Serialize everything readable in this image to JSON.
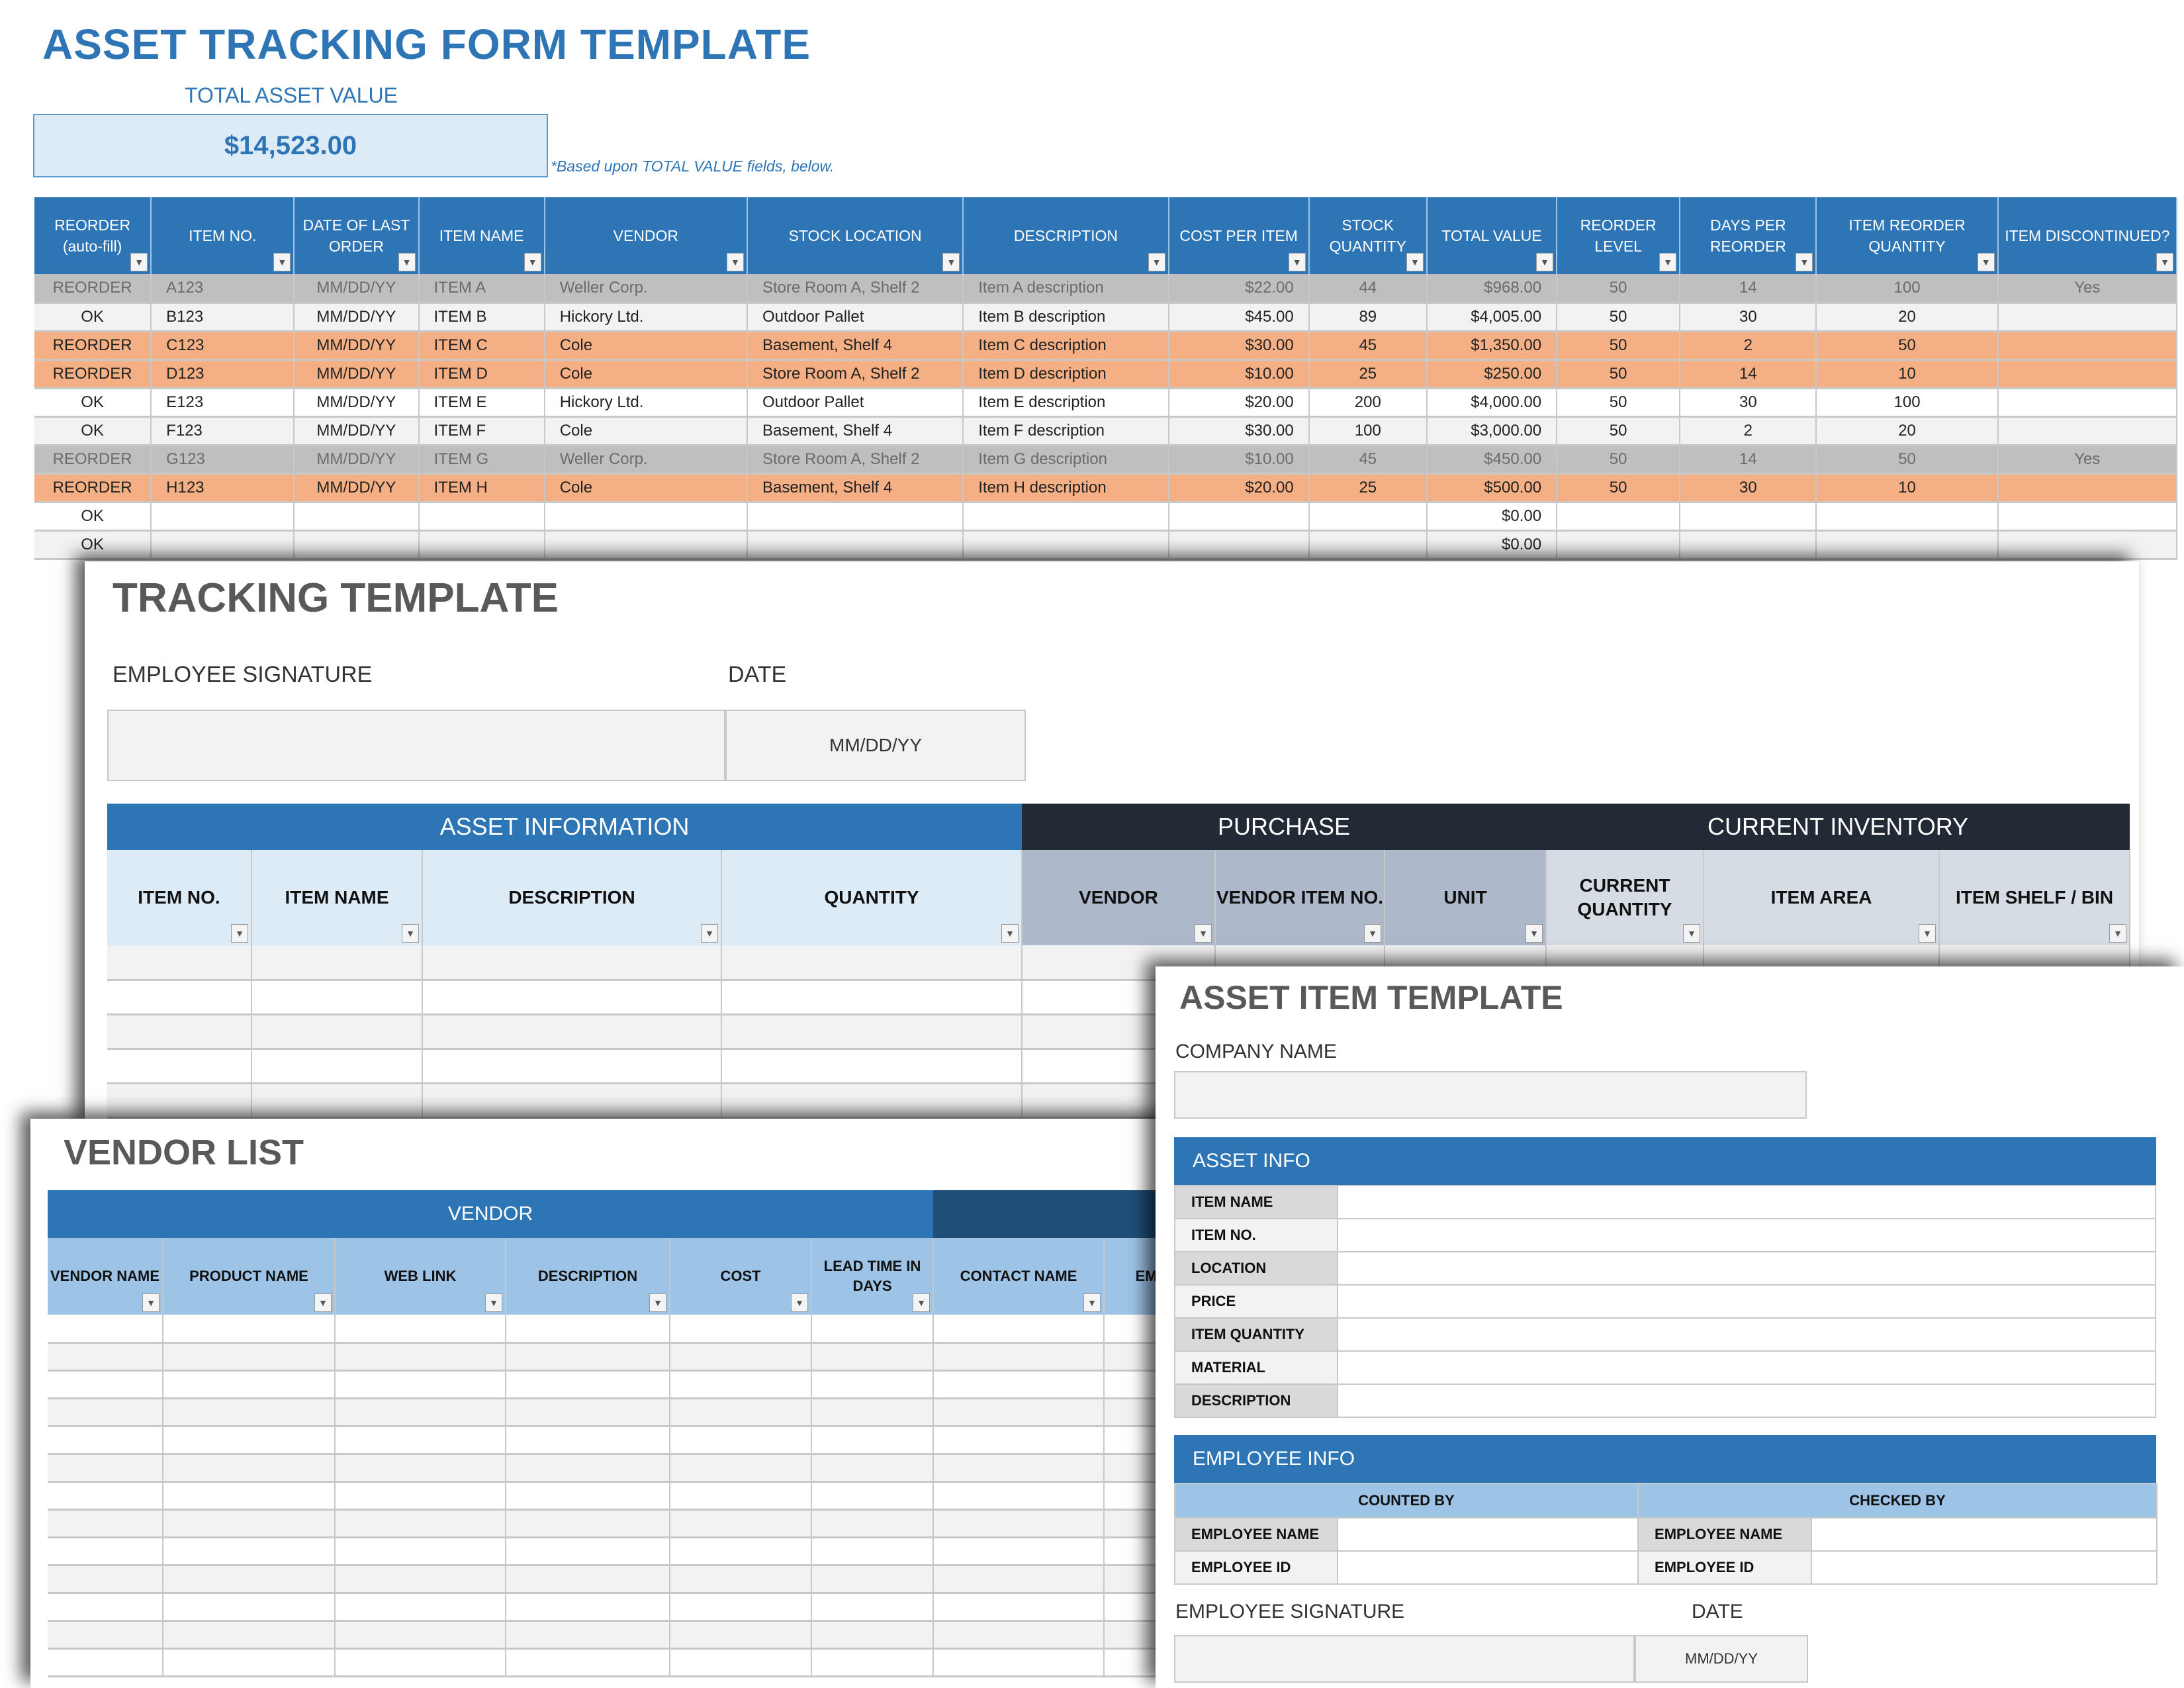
{
  "asset_form": {
    "title": "ASSET TRACKING FORM TEMPLATE",
    "total_label": "TOTAL ASSET VALUE",
    "total_value": "$14,523.00",
    "total_note": "*Based upon TOTAL VALUE fields, below.",
    "columns": [
      "REORDER (auto-fill)",
      "ITEM NO.",
      "DATE OF LAST ORDER",
      "ITEM NAME",
      "VENDOR",
      "STOCK LOCATION",
      "DESCRIPTION",
      "COST PER ITEM",
      "STOCK QUANTITY",
      "TOTAL VALUE",
      "REORDER LEVEL",
      "DAYS PER REORDER",
      "ITEM REORDER QUANTITY",
      "ITEM DISCONTINUED?"
    ],
    "filter_icon": "dropdown-arrow-icon",
    "rows": [
      {
        "status": "REORDER",
        "item_no": "A123",
        "date": "MM/DD/YY",
        "name": "ITEM A",
        "vendor": "Weller Corp.",
        "location": "Store Room A, Shelf 2",
        "description": "Item A description",
        "cost": "$22.00",
        "qty": "44",
        "total": "$968.00",
        "reorder_level": "50",
        "days": "14",
        "reorder_qty": "100",
        "discontinued": "Yes",
        "style": "disc"
      },
      {
        "status": "OK",
        "item_no": "B123",
        "date": "MM/DD/YY",
        "name": "ITEM B",
        "vendor": "Hickory Ltd.",
        "location": "Outdoor Pallet",
        "description": "Item B description",
        "cost": "$45.00",
        "qty": "89",
        "total": "$4,005.00",
        "reorder_level": "50",
        "days": "30",
        "reorder_qty": "20",
        "discontinued": "",
        "style": "ok"
      },
      {
        "status": "REORDER",
        "item_no": "C123",
        "date": "MM/DD/YY",
        "name": "ITEM C",
        "vendor": "Cole",
        "location": "Basement, Shelf 4",
        "description": "Item C description",
        "cost": "$30.00",
        "qty": "45",
        "total": "$1,350.00",
        "reorder_level": "50",
        "days": "2",
        "reorder_qty": "50",
        "discontinued": "",
        "style": "reorder"
      },
      {
        "status": "REORDER",
        "item_no": "D123",
        "date": "MM/DD/YY",
        "name": "ITEM D",
        "vendor": "Cole",
        "location": "Store Room A, Shelf 2",
        "description": "Item D description",
        "cost": "$10.00",
        "qty": "25",
        "total": "$250.00",
        "reorder_level": "50",
        "days": "14",
        "reorder_qty": "10",
        "discontinued": "",
        "style": "reorder"
      },
      {
        "status": "OK",
        "item_no": "E123",
        "date": "MM/DD/YY",
        "name": "ITEM E",
        "vendor": "Hickory Ltd.",
        "location": "Outdoor Pallet",
        "description": "Item E description",
        "cost": "$20.00",
        "qty": "200",
        "total": "$4,000.00",
        "reorder_level": "50",
        "days": "30",
        "reorder_qty": "100",
        "discontinued": "",
        "style": "okw"
      },
      {
        "status": "OK",
        "item_no": "F123",
        "date": "MM/DD/YY",
        "name": "ITEM F",
        "vendor": "Cole",
        "location": "Basement, Shelf 4",
        "description": "Item F description",
        "cost": "$30.00",
        "qty": "100",
        "total": "$3,000.00",
        "reorder_level": "50",
        "days": "2",
        "reorder_qty": "20",
        "discontinued": "",
        "style": "ok"
      },
      {
        "status": "REORDER",
        "item_no": "G123",
        "date": "MM/DD/YY",
        "name": "ITEM G",
        "vendor": "Weller Corp.",
        "location": "Store Room A, Shelf 2",
        "description": "Item G description",
        "cost": "$10.00",
        "qty": "45",
        "total": "$450.00",
        "reorder_level": "50",
        "days": "14",
        "reorder_qty": "50",
        "discontinued": "Yes",
        "style": "disc"
      },
      {
        "status": "REORDER",
        "item_no": "H123",
        "date": "MM/DD/YY",
        "name": "ITEM H",
        "vendor": "Cole",
        "location": "Basement, Shelf 4",
        "description": "Item H description",
        "cost": "$20.00",
        "qty": "25",
        "total": "$500.00",
        "reorder_level": "50",
        "days": "30",
        "reorder_qty": "10",
        "discontinued": "",
        "style": "reorder"
      },
      {
        "status": "OK",
        "item_no": "",
        "date": "",
        "name": "",
        "vendor": "",
        "location": "",
        "description": "",
        "cost": "",
        "qty": "",
        "total": "$0.00",
        "reorder_level": "",
        "days": "",
        "reorder_qty": "",
        "discontinued": "",
        "style": "okw"
      },
      {
        "status": "OK",
        "item_no": "",
        "date": "",
        "name": "",
        "vendor": "",
        "location": "",
        "description": "",
        "cost": "",
        "qty": "",
        "total": "$0.00",
        "reorder_level": "",
        "days": "",
        "reorder_qty": "",
        "discontinued": "",
        "style": "ok"
      }
    ]
  },
  "tracking_template": {
    "title": "TRACKING TEMPLATE",
    "signature_label": "EMPLOYEE SIGNATURE",
    "date_label": "DATE",
    "date_placeholder": "MM/DD/YY",
    "groups": [
      "ASSET INFORMATION",
      "PURCHASE",
      "CURRENT INVENTORY"
    ],
    "columns": [
      "ITEM NO.",
      "ITEM NAME",
      "DESCRIPTION",
      "QUANTITY",
      "VENDOR",
      "VENDOR ITEM NO.",
      "UNIT",
      "CURRENT QUANTITY",
      "ITEM AREA",
      "ITEM SHELF / BIN"
    ]
  },
  "vendor_list": {
    "title": "VENDOR LIST",
    "group": "VENDOR",
    "columns": [
      "VENDOR NAME",
      "PRODUCT NAME",
      "WEB LINK",
      "DESCRIPTION",
      "COST",
      "LEAD TIME IN DAYS",
      "CONTACT NAME",
      "EMA"
    ]
  },
  "asset_item_template": {
    "title": "ASSET ITEM TEMPLATE",
    "company_label": "COMPANY NAME",
    "asset_info_header": "ASSET INFO",
    "asset_fields": [
      "ITEM NAME",
      "ITEM NO.",
      "LOCATION",
      "PRICE",
      "ITEM QUANTITY",
      "MATERIAL",
      "DESCRIPTION"
    ],
    "employee_info_header": "EMPLOYEE INFO",
    "counted_by": "COUNTED BY",
    "checked_by": "CHECKED BY",
    "employee_name": "EMPLOYEE NAME",
    "employee_id": "EMPLOYEE ID",
    "signature_label": "EMPLOYEE SIGNATURE",
    "date_label": "DATE",
    "date_placeholder": "MM/DD/YY"
  },
  "colors": {
    "header_blue": "#2e75b6",
    "header_dark": "#222a35",
    "reorder_orange": "#f4b084",
    "discontinued_gray": "#bfbfbf",
    "light_blue": "#9dc3e6",
    "pale_blue": "#ddebf7"
  }
}
